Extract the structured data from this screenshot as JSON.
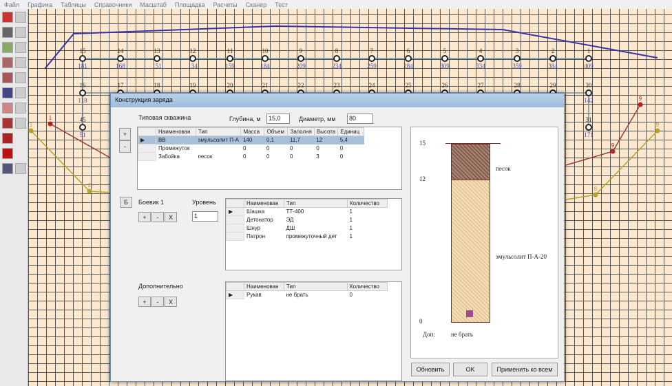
{
  "menu": [
    "Файл",
    "Графика",
    "Таблицы",
    "Справочники",
    "Масштаб",
    "Площадка",
    "Расчеты",
    "Сканер",
    "Тест"
  ],
  "nodes_row1": {
    "ids": [
      "15",
      "14",
      "13",
      "12",
      "11",
      "10",
      "9",
      "8",
      "7",
      "6",
      "5",
      "4",
      "3",
      "2",
      "1"
    ],
    "values": [
      "181",
      "168",
      "151",
      "134",
      "159",
      "184",
      "209",
      "234",
      "259",
      "284",
      "309",
      "334",
      "359",
      "384",
      "409"
    ]
  },
  "nodes_row2": {
    "ids": [
      "16",
      "17",
      "18",
      "19",
      "20",
      "21",
      "22",
      "23",
      "24",
      "25",
      "26",
      "27",
      "28",
      "29",
      "30"
    ],
    "first_value": "118",
    "last_value": "142"
  },
  "nodes_row3": {
    "left_id": "45",
    "left_value": "51",
    "right_id": "31",
    "right_value": "171"
  },
  "markers": {
    "red_left": "1",
    "red_right": "9",
    "yellow_left": "1",
    "yellow_right": "9",
    "yellow_left2": "2",
    "yellow_right2": "8"
  },
  "dialog": {
    "title": "Конструкция заряда",
    "typical_label": "Типовая скважина",
    "depth_label": "Глубина, м",
    "depth_value": "15,0",
    "diameter_label": "Диаметр, мм",
    "diameter_value": "80",
    "plus": "+",
    "minus": "-",
    "x": "X",
    "b_button": "Б",
    "charge_table": {
      "headers": [
        "Наименован",
        "Тип",
        "Масса",
        "Объем",
        "Заполня",
        "Высота",
        "Единиц"
      ],
      "rows": [
        [
          "ВВ",
          "эмульсолит П-А",
          "140",
          "0,1",
          "11,7",
          "12",
          "5,4"
        ],
        [
          "Промежуток",
          "",
          "0",
          "0",
          "0",
          "0",
          "0"
        ],
        [
          "Забойка",
          "песок",
          "0",
          "0",
          "0",
          "3",
          "0"
        ]
      ]
    },
    "booster_label": "Боевик 1",
    "level_label": "Уровень",
    "level_value": "1",
    "booster_table": {
      "headers": [
        "Наименован",
        "Тип",
        "Количество"
      ],
      "rows": [
        [
          "Шашка",
          "ТТ-400",
          "1"
        ],
        [
          "Детонатор",
          "ЭД",
          "1"
        ],
        [
          "Шнур",
          "ДШ",
          "1"
        ],
        [
          "Патрон",
          "промежуточный дет",
          "1"
        ]
      ]
    },
    "extra_label": "Дополнительно",
    "extra_table": {
      "headers": [
        "Наименован",
        "Тип",
        "Количество"
      ],
      "rows": [
        [
          "Рукав",
          "не брать",
          "0"
        ]
      ]
    },
    "diagram": {
      "top": "15",
      "mid": "12",
      "bottom": "0",
      "stemming": "песок",
      "explosive": "эмульсолит П-А-20",
      "extra": "Доп:",
      "extra_value": "не брать",
      "stemming_m": 3,
      "explosive_m": 12
    },
    "buttons": {
      "refresh": "Обновить",
      "ok": "OK",
      "apply_all": "Применить ко всем"
    }
  }
}
